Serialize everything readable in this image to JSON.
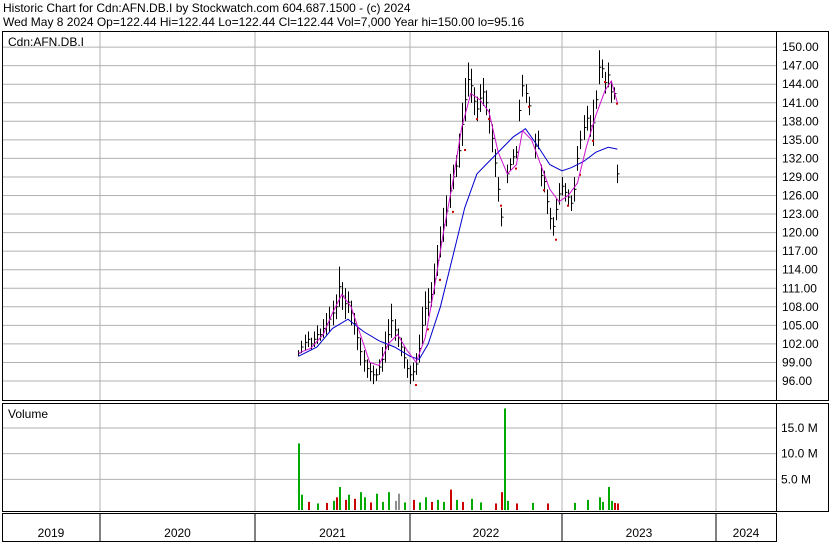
{
  "header": {
    "line1": "Historic Chart for Cdn:AFN.DB.I by Stockwatch.com 604.687.1500 - (c) 2024",
    "line2": "Wed May  8 2024   Op=122.44   Hi=122.44   Lo=122.44   Cl=122.44   Vol=7,000   Year hi=150.00   lo=95.16"
  },
  "chart_data": [
    {
      "type": "line",
      "title": "Cdn:AFN.DB.I",
      "y_ticks": [
        96,
        99,
        102,
        105,
        108,
        111,
        114,
        117,
        120,
        123,
        126,
        129,
        132,
        135,
        138,
        141,
        144,
        147,
        150
      ],
      "ylim": [
        94,
        151
      ],
      "x_labels": [
        "2019",
        "2020",
        "2021",
        "2022",
        "2023",
        "2024"
      ],
      "xlim": [
        2019.0,
        2024.42
      ],
      "grid": true,
      "price_bars": [
        [
          2021.28,
          100.0,
          101.0
        ],
        [
          2021.3,
          100.5,
          102.5
        ],
        [
          2021.32,
          101.0,
          103.5
        ],
        [
          2021.34,
          101.5,
          104.0
        ],
        [
          2021.36,
          101.0,
          103.0
        ],
        [
          2021.38,
          101.5,
          104.0
        ],
        [
          2021.4,
          102.0,
          105.0
        ],
        [
          2021.42,
          102.5,
          104.5
        ],
        [
          2021.44,
          103.0,
          106.0
        ],
        [
          2021.46,
          103.5,
          107.0
        ],
        [
          2021.48,
          104.0,
          108.0
        ],
        [
          2021.5,
          105.0,
          109.0
        ],
        [
          2021.52,
          106.0,
          110.0
        ],
        [
          2021.54,
          108.0,
          114.5
        ],
        [
          2021.56,
          107.5,
          112.0
        ],
        [
          2021.58,
          106.0,
          111.0
        ],
        [
          2021.6,
          107.0,
          110.5
        ],
        [
          2021.62,
          105.0,
          109.0
        ],
        [
          2021.64,
          103.5,
          107.0
        ],
        [
          2021.66,
          101.0,
          105.0
        ],
        [
          2021.68,
          98.5,
          103.0
        ],
        [
          2021.7,
          97.5,
          101.0
        ],
        [
          2021.72,
          96.5,
          99.5
        ],
        [
          2021.74,
          96.0,
          99.0
        ],
        [
          2021.76,
          95.5,
          98.5
        ],
        [
          2021.78,
          96.0,
          98.0
        ],
        [
          2021.8,
          97.0,
          99.5
        ],
        [
          2021.82,
          97.5,
          101.5
        ],
        [
          2021.84,
          99.0,
          104.0
        ],
        [
          2021.86,
          101.0,
          106.0
        ],
        [
          2021.88,
          103.0,
          108.5
        ],
        [
          2021.9,
          102.5,
          106.0
        ],
        [
          2021.92,
          101.5,
          104.5
        ],
        [
          2021.94,
          100.0,
          103.0
        ],
        [
          2021.96,
          98.0,
          101.5
        ],
        [
          2021.98,
          96.5,
          99.5
        ],
        [
          2022.0,
          95.5,
          98.5
        ],
        [
          2022.02,
          96.0,
          99.0
        ],
        [
          2022.04,
          97.0,
          100.5
        ],
        [
          2022.06,
          99.0,
          103.5
        ],
        [
          2022.08,
          102.0,
          108.0
        ],
        [
          2022.1,
          105.0,
          110.5
        ],
        [
          2022.12,
          106.5,
          111.0
        ],
        [
          2022.14,
          108.0,
          112.0
        ],
        [
          2022.16,
          110.0,
          115.0
        ],
        [
          2022.18,
          113.0,
          118.0
        ],
        [
          2022.2,
          116.0,
          121.0
        ],
        [
          2022.22,
          118.5,
          124.0
        ],
        [
          2022.24,
          121.0,
          126.0
        ],
        [
          2022.26,
          124.0,
          129.5
        ],
        [
          2022.28,
          127.0,
          131.0
        ],
        [
          2022.3,
          129.0,
          132.5
        ],
        [
          2022.32,
          130.5,
          136.0
        ],
        [
          2022.34,
          134.0,
          141.0
        ],
        [
          2022.36,
          138.0,
          145.0
        ],
        [
          2022.38,
          142.0,
          147.5
        ],
        [
          2022.4,
          141.0,
          146.5
        ],
        [
          2022.42,
          139.0,
          143.5
        ],
        [
          2022.44,
          138.0,
          142.0
        ],
        [
          2022.46,
          139.5,
          144.0
        ],
        [
          2022.48,
          140.5,
          145.0
        ],
        [
          2022.5,
          139.0,
          143.0
        ],
        [
          2022.52,
          136.0,
          140.0
        ],
        [
          2022.54,
          133.0,
          137.5
        ],
        [
          2022.56,
          129.0,
          133.5
        ],
        [
          2022.58,
          125.0,
          129.0
        ],
        [
          2022.6,
          121.0,
          124.0
        ],
        [
          2022.64,
          128.0,
          131.0
        ],
        [
          2022.66,
          130.0,
          132.0
        ],
        [
          2022.68,
          131.0,
          133.5
        ],
        [
          2022.7,
          132.0,
          134.0
        ],
        [
          2022.72,
          138.0,
          141.5
        ],
        [
          2022.74,
          142.0,
          145.5
        ],
        [
          2022.76,
          141.0,
          144.0
        ],
        [
          2022.78,
          139.0,
          142.0
        ],
        [
          2022.82,
          132.0,
          136.0
        ],
        [
          2022.84,
          133.5,
          136.5
        ],
        [
          2022.86,
          127.5,
          131.0
        ],
        [
          2022.88,
          126.5,
          130.0
        ],
        [
          2022.9,
          123.0,
          127.0
        ],
        [
          2022.92,
          120.5,
          124.0
        ],
        [
          2022.94,
          119.5,
          122.5
        ],
        [
          2022.96,
          122.0,
          125.5
        ],
        [
          2022.98,
          124.5,
          128.0
        ],
        [
          2023.0,
          126.0,
          129.0
        ],
        [
          2023.02,
          125.0,
          128.0
        ],
        [
          2023.04,
          124.5,
          127.0
        ],
        [
          2023.06,
          123.5,
          126.0
        ],
        [
          2023.08,
          125.0,
          129.0
        ],
        [
          2023.1,
          130.0,
          134.0
        ],
        [
          2023.12,
          133.5,
          136.5
        ],
        [
          2023.14,
          135.0,
          139.0
        ],
        [
          2023.16,
          136.5,
          140.5
        ],
        [
          2023.18,
          135.5,
          139.0
        ],
        [
          2023.2,
          134.0,
          141.5
        ],
        [
          2023.22,
          140.0,
          143.0
        ],
        [
          2023.24,
          144.0,
          149.5
        ],
        [
          2023.26,
          145.0,
          148.0
        ],
        [
          2023.28,
          142.5,
          146.0
        ],
        [
          2023.3,
          143.5,
          147.5
        ],
        [
          2023.32,
          141.0,
          144.5
        ],
        [
          2023.34,
          141.5,
          143.5
        ],
        [
          2023.36,
          128.0,
          131.0
        ]
      ],
      "moving_average_short": [
        [
          2021.28,
          100.5
        ],
        [
          2021.36,
          101.3
        ],
        [
          2021.44,
          103.5
        ],
        [
          2021.5,
          107.0
        ],
        [
          2021.56,
          110.0
        ],
        [
          2021.62,
          108.0
        ],
        [
          2021.68,
          103.5
        ],
        [
          2021.74,
          99.0
        ],
        [
          2021.8,
          98.5
        ],
        [
          2021.86,
          102.0
        ],
        [
          2021.92,
          103.5
        ],
        [
          2021.98,
          101.0
        ],
        [
          2022.04,
          99.0
        ],
        [
          2022.1,
          103.0
        ],
        [
          2022.16,
          111.0
        ],
        [
          2022.22,
          120.0
        ],
        [
          2022.28,
          128.0
        ],
        [
          2022.34,
          137.0
        ],
        [
          2022.4,
          142.5
        ],
        [
          2022.46,
          141.5
        ],
        [
          2022.52,
          139.5
        ],
        [
          2022.58,
          133.0
        ],
        [
          2022.64,
          129.5
        ],
        [
          2022.7,
          131.0
        ],
        [
          2022.74,
          136.5
        ],
        [
          2022.8,
          135.0
        ],
        [
          2022.86,
          131.0
        ],
        [
          2022.92,
          127.0
        ],
        [
          2022.98,
          125.0
        ],
        [
          2023.04,
          126.0
        ],
        [
          2023.1,
          128.0
        ],
        [
          2023.16,
          134.0
        ],
        [
          2023.22,
          139.0
        ],
        [
          2023.28,
          143.0
        ],
        [
          2023.32,
          144.5
        ],
        [
          2023.36,
          141.0
        ]
      ],
      "moving_average_long": [
        [
          2021.28,
          100.0
        ],
        [
          2021.4,
          101.5
        ],
        [
          2021.5,
          104.5
        ],
        [
          2021.6,
          106.0
        ],
        [
          2021.7,
          104.0
        ],
        [
          2021.8,
          102.5
        ],
        [
          2021.9,
          101.5
        ],
        [
          2022.0,
          100.0
        ],
        [
          2022.06,
          99.5
        ],
        [
          2022.12,
          102.0
        ],
        [
          2022.2,
          108.0
        ],
        [
          2022.28,
          116.0
        ],
        [
          2022.36,
          124.0
        ],
        [
          2022.44,
          129.5
        ],
        [
          2022.52,
          131.5
        ],
        [
          2022.6,
          133.5
        ],
        [
          2022.68,
          135.5
        ],
        [
          2022.76,
          136.8
        ],
        [
          2022.84,
          134.0
        ],
        [
          2022.92,
          131.0
        ],
        [
          2023.0,
          130.0
        ],
        [
          2023.06,
          130.5
        ],
        [
          2023.14,
          131.5
        ],
        [
          2023.22,
          133.0
        ],
        [
          2023.3,
          133.8
        ],
        [
          2023.36,
          133.5
        ]
      ]
    },
    {
      "type": "bar",
      "title": "Volume",
      "y_ticks": [
        5,
        10,
        15
      ],
      "y_tick_labels": [
        "5.0 M",
        "10.0 M",
        "15.0 M"
      ],
      "ylim": [
        0,
        20
      ],
      "bars": [
        [
          2021.28,
          12.0,
          "up"
        ],
        [
          2021.3,
          2.0,
          "up"
        ],
        [
          2021.34,
          0.6,
          "down"
        ],
        [
          2021.4,
          0.3,
          "up"
        ],
        [
          2021.46,
          0.4,
          "down"
        ],
        [
          2021.5,
          0.8,
          "up"
        ],
        [
          2021.52,
          1.5,
          "down"
        ],
        [
          2021.54,
          3.5,
          "up"
        ],
        [
          2021.58,
          1.0,
          "down"
        ],
        [
          2021.6,
          2.0,
          "up"
        ],
        [
          2021.64,
          1.2,
          "down"
        ],
        [
          2021.68,
          2.5,
          "up"
        ],
        [
          2021.7,
          1.5,
          "up"
        ],
        [
          2021.74,
          0.5,
          "down"
        ],
        [
          2021.78,
          2.2,
          "up"
        ],
        [
          2021.82,
          0.6,
          "up"
        ],
        [
          2021.86,
          2.5,
          "up"
        ],
        [
          2021.9,
          0.8,
          "neutral"
        ],
        [
          2021.92,
          2.2,
          "neutral"
        ],
        [
          2021.96,
          0.5,
          "up"
        ],
        [
          2022.02,
          1.0,
          "down"
        ],
        [
          2022.06,
          0.5,
          "up"
        ],
        [
          2022.1,
          1.5,
          "up"
        ],
        [
          2022.14,
          0.6,
          "down"
        ],
        [
          2022.18,
          1.0,
          "up"
        ],
        [
          2022.22,
          0.6,
          "up"
        ],
        [
          2022.26,
          3.0,
          "down"
        ],
        [
          2022.3,
          1.0,
          "up"
        ],
        [
          2022.34,
          0.6,
          "down"
        ],
        [
          2022.4,
          1.2,
          "up"
        ],
        [
          2022.46,
          0.5,
          "up"
        ],
        [
          2022.56,
          0.3,
          "down"
        ],
        [
          2022.6,
          2.5,
          "down"
        ],
        [
          2022.62,
          18.8,
          "up"
        ],
        [
          2022.64,
          0.8,
          "up"
        ],
        [
          2022.7,
          0.3,
          "down"
        ],
        [
          2022.8,
          0.4,
          "up"
        ],
        [
          2022.9,
          0.3,
          "down"
        ],
        [
          2023.08,
          0.4,
          "up"
        ],
        [
          2023.16,
          1.0,
          "up"
        ],
        [
          2023.24,
          1.5,
          "up"
        ],
        [
          2023.26,
          0.6,
          "up"
        ],
        [
          2023.3,
          3.5,
          "up"
        ],
        [
          2023.32,
          0.8,
          "up"
        ],
        [
          2023.34,
          0.4,
          "down"
        ],
        [
          2023.36,
          0.3,
          "down"
        ]
      ]
    }
  ],
  "colors": {
    "border": "#000000",
    "grid": "#b0b0b0",
    "price_bar": "#000000",
    "ma_short": "#d010d0",
    "ma_long": "#0000cc",
    "vol_up": "#00aa00",
    "vol_down": "#cc0000",
    "vol_neutral": "#909090",
    "marker": "#cc0000"
  }
}
